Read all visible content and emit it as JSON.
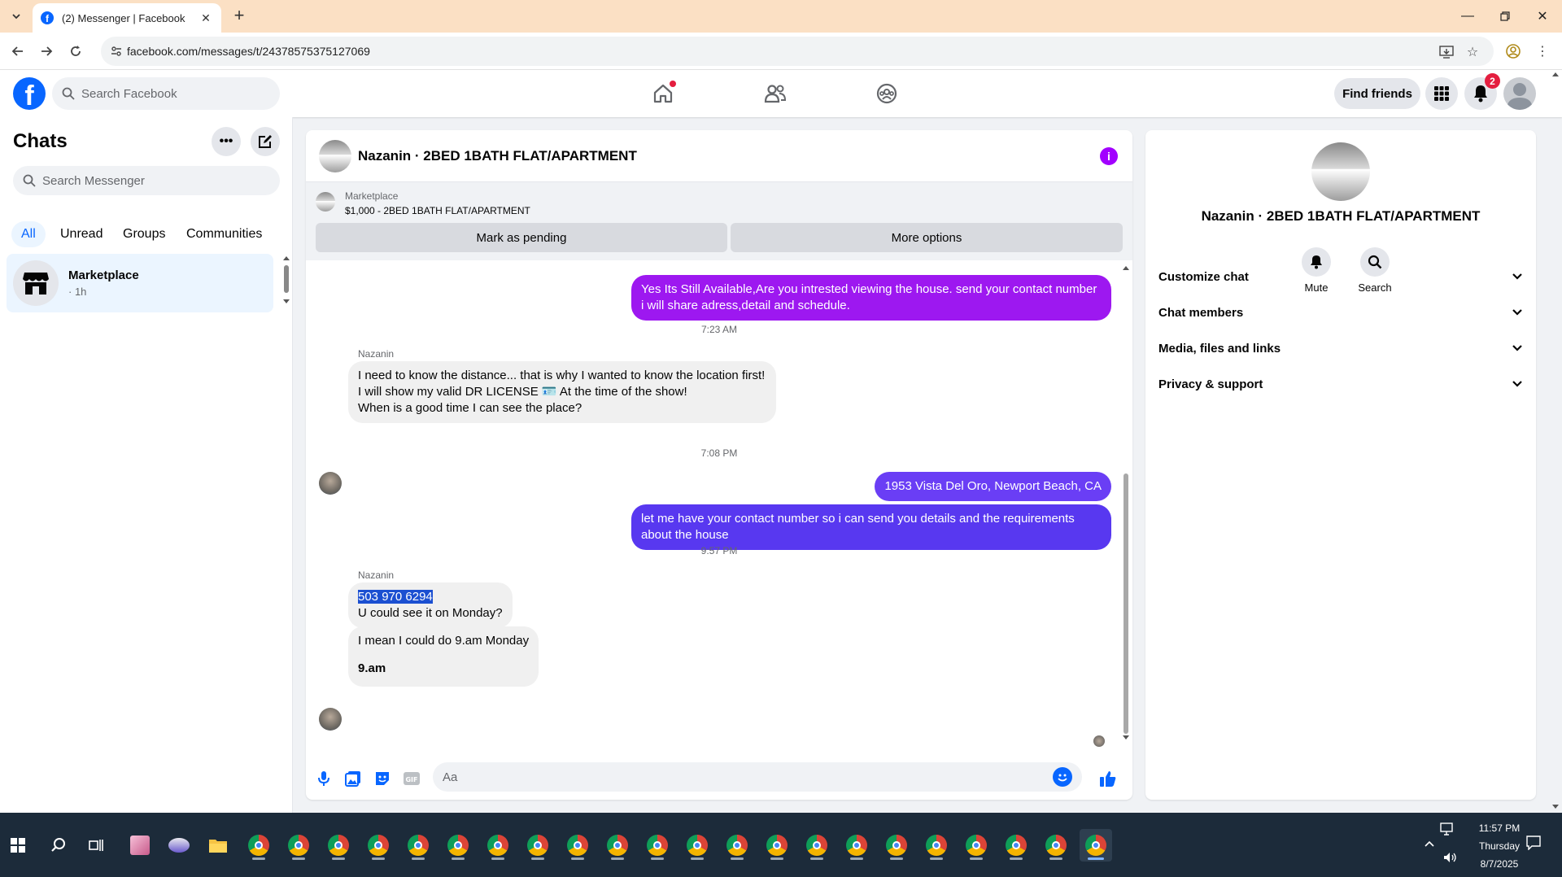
{
  "browser": {
    "tab_title": "(2) Messenger | Facebook",
    "url": "facebook.com/messages/t/24378575375127069"
  },
  "fb": {
    "search_placeholder": "Search Facebook",
    "find_friends": "Find friends",
    "notification_count": "2"
  },
  "sidebar": {
    "title": "Chats",
    "search_placeholder": "Search Messenger",
    "filters": [
      "All",
      "Unread",
      "Groups",
      "Communities"
    ],
    "active_filter": "All",
    "chats": [
      {
        "name": "Marketplace",
        "meta": "· 1h"
      }
    ]
  },
  "conversation": {
    "title": "Nazanin · 2BED 1BATH FLAT/APARTMENT",
    "marketplace_label": "Marketplace",
    "listing": "$1,000 - 2BED 1BATH FLAT/APARTMENT",
    "buttons": {
      "mark_pending": "Mark as pending",
      "more_options": "More options"
    },
    "messages": [
      {
        "type": "out",
        "text": "Yes Its Still Available,Are you intrested viewing the house. send your contact number i will share adress,detail and schedule."
      },
      {
        "type": "time",
        "text": "7:23 AM"
      },
      {
        "type": "sender",
        "text": "Nazanin"
      },
      {
        "type": "in",
        "lines": [
          "I need to know the distance... that is why I wanted to know the location first!",
          "I will show my valid DR LICENSE 🪪 At the time of the show!",
          "When is a good time I can see the place?"
        ]
      },
      {
        "type": "time",
        "text": "7:08 PM"
      },
      {
        "type": "out",
        "text": "1953 Vista Del Oro, Newport Beach, CA"
      },
      {
        "type": "out",
        "text": "let me have your contact number so i can send you details and the requirements about the house"
      },
      {
        "type": "time",
        "text": "9:57 PM"
      },
      {
        "type": "sender",
        "text": "Nazanin"
      },
      {
        "type": "in",
        "highlight": "503 970 6294",
        "text": "U could see it on Monday?"
      },
      {
        "type": "in",
        "text": "I mean I could do 9.am Monday",
        "bold": "9.am"
      }
    ],
    "composer_placeholder": "Aa"
  },
  "info_panel": {
    "name": "Nazanin · 2BED 1BATH FLAT/APARTMENT",
    "actions": [
      "Mute",
      "Search"
    ],
    "sections": [
      "Customize chat",
      "Chat members",
      "Media, files and links",
      "Privacy & support"
    ]
  },
  "taskbar": {
    "time": "11:57 PM",
    "day": "Thursday",
    "date": "8/7/2025"
  },
  "colors": {
    "fb_blue": "#0866ff",
    "outgoing_bubble": "#8a2be2",
    "info_icon": "#a200ff"
  }
}
